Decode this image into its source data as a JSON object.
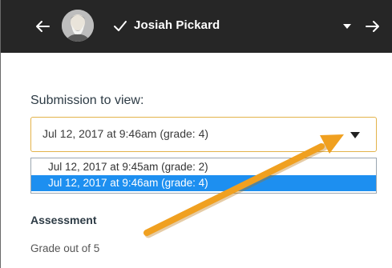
{
  "header": {
    "prev_icon": "arrow-left-icon",
    "avatar_icon": "student-avatar",
    "status_icon": "checkmark-icon",
    "student_name": "Josiah Pickard",
    "student_menu_icon": "caret-down-icon",
    "next_icon": "arrow-right-icon",
    "background_color": "#262626"
  },
  "submission": {
    "label": "Submission to view:",
    "selected_value": "Jul 12, 2017 at 9:46am (grade: 4)",
    "caret_icon": "caret-down-icon",
    "border_color": "#e3b34a",
    "options": [
      {
        "label": "Jul 12, 2017 at 9:45am (grade: 2)",
        "highlighted": false
      },
      {
        "label": "Jul 12, 2017 at 9:46am (grade: 4)",
        "highlighted": true
      }
    ],
    "highlight_color": "#1d8ff0"
  },
  "assessment": {
    "heading": "Assessment",
    "grade_label": "Grade out of 5"
  },
  "annotation": {
    "icon": "orange-pointer-arrow",
    "color": "#f0a020"
  }
}
